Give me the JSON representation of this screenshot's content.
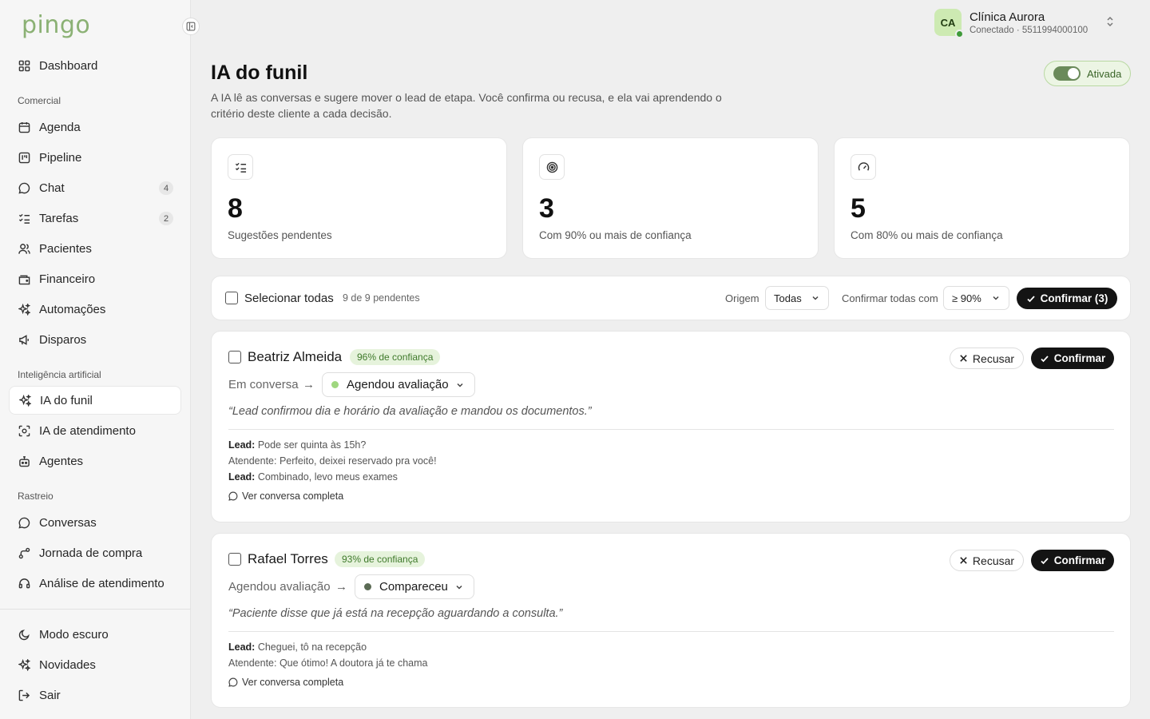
{
  "brand": {
    "logo": "pingo",
    "accent": "#8bb174"
  },
  "sidebar": {
    "top_items": [
      {
        "label": "Dashboard",
        "icon": "dashboard-icon"
      }
    ],
    "sections": [
      {
        "title": "Comercial",
        "items": [
          {
            "label": "Agenda",
            "icon": "calendar-icon"
          },
          {
            "label": "Pipeline",
            "icon": "kanban-icon"
          },
          {
            "label": "Chat",
            "icon": "chat-icon",
            "badge": "4"
          },
          {
            "label": "Tarefas",
            "icon": "tasks-icon",
            "badge": "2"
          },
          {
            "label": "Pacientes",
            "icon": "users-icon"
          },
          {
            "label": "Financeiro",
            "icon": "wallet-icon"
          },
          {
            "label": "Automações",
            "icon": "sparkles-icon"
          },
          {
            "label": "Disparos",
            "icon": "megaphone-icon"
          }
        ]
      },
      {
        "title": "Inteligência artificial",
        "items": [
          {
            "label": "IA do funil",
            "icon": "sparkles-icon",
            "active": true
          },
          {
            "label": "IA de atendimento",
            "icon": "scan-icon"
          },
          {
            "label": "Agentes",
            "icon": "robot-icon"
          }
        ]
      },
      {
        "title": "Rastreio",
        "items": [
          {
            "label": "Conversas",
            "icon": "chat-icon"
          },
          {
            "label": "Jornada de compra",
            "icon": "route-icon"
          },
          {
            "label": "Análise de atendimento",
            "icon": "headset-icon"
          }
        ]
      }
    ],
    "bottom_items": [
      {
        "label": "Modo escuro",
        "icon": "moon-icon"
      },
      {
        "label": "Novidades",
        "icon": "sparkles-icon"
      },
      {
        "label": "Sair",
        "icon": "logout-icon"
      }
    ]
  },
  "account": {
    "initials": "CA",
    "name": "Clínica Aurora",
    "status": "Conectado · 5511994000100"
  },
  "header": {
    "title": "IA do funil",
    "description": "A IA lê as conversas e sugere mover o lead de etapa. Você confirma ou recusa, e ela vai aprendendo o critério deste cliente a cada decisão.",
    "toggle_label": "Ativada",
    "toggle_on": true
  },
  "stats": [
    {
      "value": "8",
      "label": "Sugestões pendentes",
      "icon": "checklist-icon"
    },
    {
      "value": "3",
      "label": "Com 90% ou mais de confiança",
      "icon": "target-icon"
    },
    {
      "value": "5",
      "label": "Com 80% ou mais de confiança",
      "icon": "gauge-icon"
    }
  ],
  "toolbar": {
    "select_all": "Selecionar todas",
    "count": "9 de 9 pendentes",
    "origin_label": "Origem",
    "origin_value": "Todas",
    "confirm_all_label": "Confirmar todas com",
    "threshold_value": "≥ 90%",
    "confirm_button": "Confirmar (3)"
  },
  "leads": [
    {
      "name": "Beatriz Almeida",
      "confidence": "96% de confiança",
      "from_stage": "Em conversa",
      "to_stage": "Agendou avaliação",
      "to_stage_color": "#9fd77f",
      "reason": "“Lead confirmou dia e horário da avaliação e mandou os documentos.”",
      "messages": [
        {
          "speaker": "Lead:",
          "text": " Pode ser quinta às 15h?"
        },
        {
          "speaker": "",
          "text": "Atendente: Perfeito, deixei reservado pra você!"
        },
        {
          "speaker": "Lead:",
          "text": " Combinado, levo meus exames"
        }
      ],
      "link": "Ver conversa completa",
      "reject": "Recusar",
      "confirm": "Confirmar"
    },
    {
      "name": "Rafael Torres",
      "confidence": "93% de confiança",
      "from_stage": "Agendou avaliação",
      "to_stage": "Compareceu",
      "to_stage_color": "#5b6b55",
      "reason": "“Paciente disse que já está na recepção aguardando a consulta.”",
      "messages": [
        {
          "speaker": "Lead:",
          "text": " Cheguei, tô na recepção"
        },
        {
          "speaker": "",
          "text": "Atendente: Que ótimo! A doutora já te chama"
        }
      ],
      "link": "Ver conversa completa",
      "reject": "Recusar",
      "confirm": "Confirmar"
    }
  ]
}
